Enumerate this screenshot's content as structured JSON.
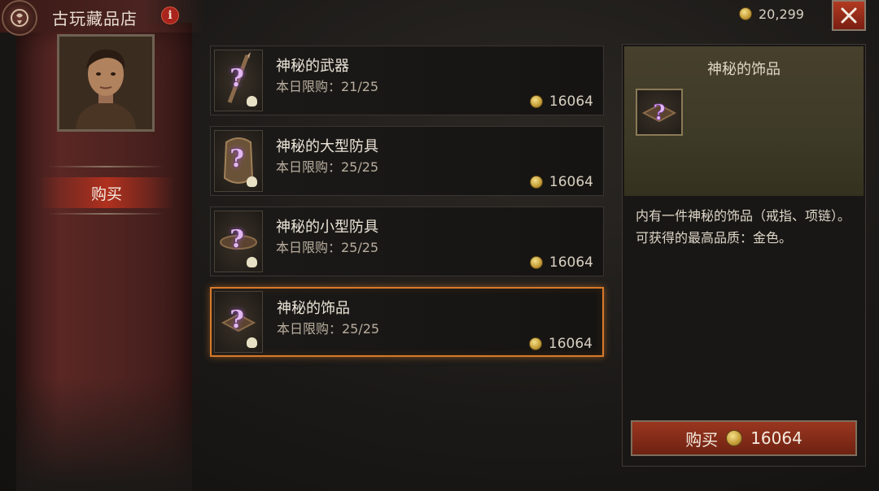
{
  "header": {
    "shop_title": "古玩藏品店",
    "info_icon": "info-icon",
    "gold_amount": "20,299",
    "close_icon": "close-icon"
  },
  "sidebar": {
    "tab_buy_label": "购买"
  },
  "items": [
    {
      "name": "神秘的武器",
      "limit": "本日限购：21/25",
      "price": "16064",
      "icon": "mystery-weapon-icon"
    },
    {
      "name": "神秘的大型防具",
      "limit": "本日限购：25/25",
      "price": "16064",
      "icon": "mystery-large-armor-icon"
    },
    {
      "name": "神秘的小型防具",
      "limit": "本日限购：25/25",
      "price": "16064",
      "icon": "mystery-small-armor-icon"
    },
    {
      "name": "神秘的饰品",
      "limit": "本日限购：25/25",
      "price": "16064",
      "icon": "mystery-jewelry-icon",
      "selected": true
    }
  ],
  "detail": {
    "title": "神秘的饰品",
    "desc_line1": "内有一件神秘的饰品（戒指、项链）。",
    "desc_line2": "可获得的最高品质：金色。",
    "buy_label": "购买",
    "buy_price": "16064"
  },
  "colors": {
    "accent_selected": "#d87a2a",
    "button_red": "#9a3620",
    "mystery_purple": "#e2b8f0"
  }
}
